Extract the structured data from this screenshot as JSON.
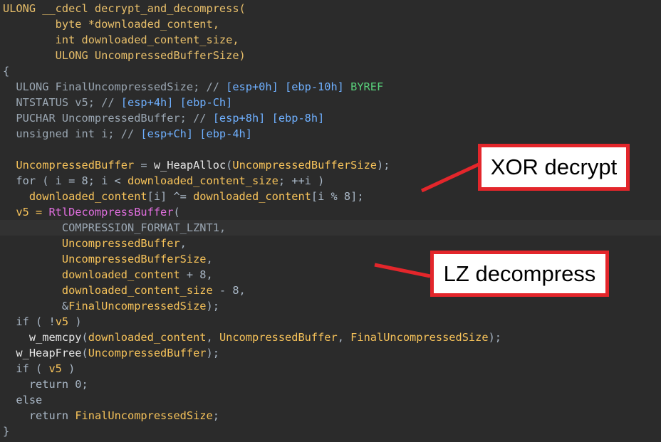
{
  "code_lines": [
    [
      {
        "t": "ULONG __cdecl decrypt_and_decompress(",
        "c": "y"
      }
    ],
    [
      {
        "t": "        byte *downloaded_content,",
        "c": "y"
      }
    ],
    [
      {
        "t": "        int downloaded_content_size,",
        "c": "y"
      }
    ],
    [
      {
        "t": "        ULONG UncompressedBufferSize)",
        "c": "y"
      }
    ],
    [
      {
        "t": "{",
        "c": "p"
      }
    ],
    [
      {
        "t": "  ULONG FinalUncompressedSize; // ",
        "c": "g"
      },
      {
        "t": "[esp+0h] [ebp-10h]",
        "c": "c"
      },
      {
        "t": " BYREF",
        "c": "gr"
      }
    ],
    [
      {
        "t": "  NTSTATUS v5; // ",
        "c": "g"
      },
      {
        "t": "[esp+4h] [ebp-Ch]",
        "c": "c"
      }
    ],
    [
      {
        "t": "  PUCHAR UncompressedBuffer; // ",
        "c": "g"
      },
      {
        "t": "[esp+8h] [ebp-8h]",
        "c": "c"
      }
    ],
    [
      {
        "t": "  unsigned int i; // ",
        "c": "g"
      },
      {
        "t": "[esp+Ch] [ebp-4h]",
        "c": "c"
      }
    ],
    [
      {
        "t": "",
        "c": "p"
      }
    ],
    [
      {
        "t": "  UncompressedBuffer",
        "c": "v"
      },
      {
        "t": " = ",
        "c": "p"
      },
      {
        "t": "w_HeapAlloc",
        "c": "f"
      },
      {
        "t": "(",
        "c": "p"
      },
      {
        "t": "UncompressedBufferSize",
        "c": "v"
      },
      {
        "t": ");",
        "c": "p"
      }
    ],
    [
      {
        "t": "  for ( i = 8; i < ",
        "c": "p"
      },
      {
        "t": "downloaded_content_size",
        "c": "v"
      },
      {
        "t": "; ++i )",
        "c": "p"
      }
    ],
    [
      {
        "t": "    ",
        "c": "p"
      },
      {
        "t": "downloaded_content",
        "c": "v"
      },
      {
        "t": "[i] ^= ",
        "c": "p"
      },
      {
        "t": "downloaded_content",
        "c": "v"
      },
      {
        "t": "[i % 8];",
        "c": "p"
      }
    ],
    [
      {
        "t": "  v5 = ",
        "c": "v"
      },
      {
        "t": "RtlDecompressBuffer",
        "c": "m"
      },
      {
        "t": "(",
        "c": "p"
      }
    ],
    [
      {
        "t": "         COMPRESSION_FORMAT_LZNT1,",
        "c": "g"
      }
    ],
    [
      {
        "t": "         UncompressedBuffer",
        "c": "v"
      },
      {
        "t": ",",
        "c": "p"
      }
    ],
    [
      {
        "t": "         UncompressedBufferSize",
        "c": "v"
      },
      {
        "t": ",",
        "c": "p"
      }
    ],
    [
      {
        "t": "         downloaded_content",
        "c": "v"
      },
      {
        "t": " + 8,",
        "c": "p"
      }
    ],
    [
      {
        "t": "         downloaded_content_size",
        "c": "v"
      },
      {
        "t": " - 8,",
        "c": "p"
      }
    ],
    [
      {
        "t": "         &",
        "c": "p"
      },
      {
        "t": "FinalUncompressedSize",
        "c": "v"
      },
      {
        "t": ");",
        "c": "p"
      }
    ],
    [
      {
        "t": "  if ( !",
        "c": "p"
      },
      {
        "t": "v5",
        "c": "v"
      },
      {
        "t": " )",
        "c": "p"
      }
    ],
    [
      {
        "t": "    ",
        "c": "p"
      },
      {
        "t": "w_memcpy",
        "c": "f"
      },
      {
        "t": "(",
        "c": "p"
      },
      {
        "t": "downloaded_content",
        "c": "v"
      },
      {
        "t": ", ",
        "c": "p"
      },
      {
        "t": "UncompressedBuffer",
        "c": "v"
      },
      {
        "t": ", ",
        "c": "p"
      },
      {
        "t": "FinalUncompressedSize",
        "c": "v"
      },
      {
        "t": ");",
        "c": "p"
      }
    ],
    [
      {
        "t": "  ",
        "c": "p"
      },
      {
        "t": "w_HeapFree",
        "c": "f"
      },
      {
        "t": "(",
        "c": "p"
      },
      {
        "t": "UncompressedBuffer",
        "c": "v"
      },
      {
        "t": ");",
        "c": "p"
      }
    ],
    [
      {
        "t": "  if ( ",
        "c": "p"
      },
      {
        "t": "v5",
        "c": "v"
      },
      {
        "t": " )",
        "c": "p"
      }
    ],
    [
      {
        "t": "    return 0;",
        "c": "p"
      }
    ],
    [
      {
        "t": "  else",
        "c": "p"
      }
    ],
    [
      {
        "t": "    return ",
        "c": "p"
      },
      {
        "t": "FinalUncompressedSize",
        "c": "v"
      },
      {
        "t": ";",
        "c": "p"
      }
    ],
    [
      {
        "t": "}",
        "c": "p"
      }
    ]
  ],
  "annotations": {
    "xor": {
      "label": "XOR decrypt"
    },
    "lz": {
      "label": "LZ decompress"
    }
  },
  "colors": {
    "background": "#2b2b2b",
    "annotation_border": "#e3262b",
    "type_yellow": "#e8bf6a",
    "variable_orange": "#f7c35a",
    "comment_blue": "#6fb0ff",
    "byref_green": "#58d07a",
    "api_magenta": "#e26fe0"
  }
}
